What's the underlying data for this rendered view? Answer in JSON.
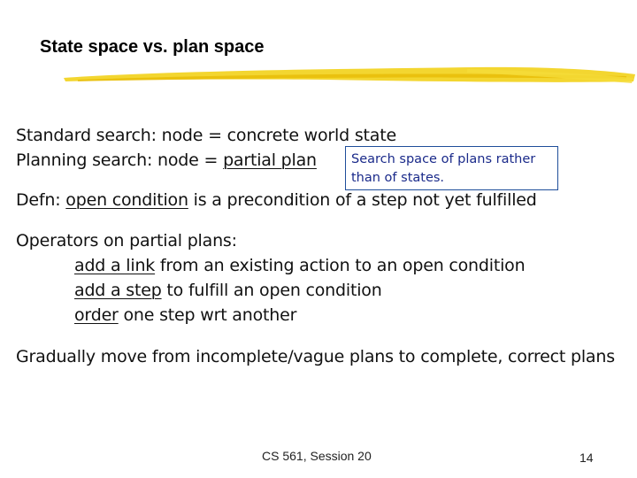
{
  "slide": {
    "title": "State space vs. plan space",
    "accent_color": "#f2d21a",
    "lines": {
      "standard_search": "Standard search:  node = concrete world state",
      "planning_search_prefix": "Planning search:  node = ",
      "planning_search_underlined": "partial plan",
      "defn_prefix": "Defn:  ",
      "defn_underlined": "open condition",
      "defn_suffix": " is a precondition of a step not yet fulfilled",
      "operators_heading": "Operators on partial plans:",
      "op1_underlined": "add a link",
      "op1_rest": " from an existing action to an open condition",
      "op2_underlined": "add a step",
      "op2_rest": " to fulfill an open condition",
      "op3_underlined": "order",
      "op3_rest": " one step wrt another",
      "gradually": "Gradually move from incomplete/vague plans to complete, correct plans"
    },
    "callout": {
      "text": "Search space of plans rather than of states."
    },
    "footer": {
      "course": "CS 561,  Session 20",
      "page_number": "14"
    }
  }
}
